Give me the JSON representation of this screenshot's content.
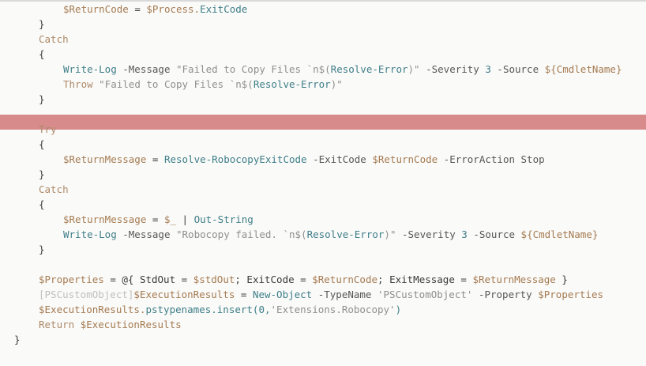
{
  "editor": {
    "lines": [
      {
        "indent": 80,
        "tokens": [
          {
            "t": "$ReturnCode",
            "c": "var"
          },
          {
            "t": " = ",
            "c": "plain"
          },
          {
            "t": "$Process.",
            "c": "var"
          },
          {
            "t": "ExitCode",
            "c": "cmd"
          }
        ]
      },
      {
        "indent": 49,
        "tokens": [
          {
            "t": "}",
            "c": "br"
          }
        ]
      },
      {
        "indent": 49,
        "tokens": [
          {
            "t": "Catch",
            "c": "kw"
          }
        ]
      },
      {
        "indent": 49,
        "tokens": [
          {
            "t": "{",
            "c": "br"
          }
        ]
      },
      {
        "indent": 80,
        "tokens": [
          {
            "t": "Write-Log",
            "c": "cmd"
          },
          {
            "t": " -Message ",
            "c": "param"
          },
          {
            "t": "\"Failed to Copy Files `n$(",
            "c": "str"
          },
          {
            "t": "Resolve-Error",
            "c": "cmd"
          },
          {
            "t": ")\"",
            "c": "str"
          },
          {
            "t": " -Severity ",
            "c": "param"
          },
          {
            "t": "3",
            "c": "cmd"
          },
          {
            "t": " -Source ",
            "c": "param"
          },
          {
            "t": "${CmdletName}",
            "c": "var"
          }
        ]
      },
      {
        "indent": 80,
        "tokens": [
          {
            "t": "Throw",
            "c": "kw"
          },
          {
            "t": " \"Failed to Copy Files `n$(",
            "c": "str"
          },
          {
            "t": "Resolve-Error",
            "c": "cmd"
          },
          {
            "t": ")\"",
            "c": "str"
          }
        ]
      },
      {
        "indent": 49,
        "tokens": [
          {
            "t": "}",
            "c": "br"
          }
        ]
      },
      {
        "indent": 0,
        "tokens": []
      },
      {
        "indent": 49,
        "tokens": [
          {
            "t": "Try",
            "c": "kw"
          }
        ]
      },
      {
        "indent": 49,
        "tokens": [
          {
            "t": "{",
            "c": "br"
          }
        ]
      },
      {
        "indent": 80,
        "tokens": [
          {
            "t": "$ReturnMessage",
            "c": "var"
          },
          {
            "t": " = ",
            "c": "plain"
          },
          {
            "t": "Resolve-RobocopyExitCode",
            "c": "cmd"
          },
          {
            "t": " -ExitCode ",
            "c": "param"
          },
          {
            "t": "$ReturnCode",
            "c": "var"
          },
          {
            "t": " -ErrorAction Stop",
            "c": "param"
          }
        ]
      },
      {
        "indent": 49,
        "tokens": [
          {
            "t": "}",
            "c": "br"
          }
        ]
      },
      {
        "indent": 49,
        "tokens": [
          {
            "t": "Catch",
            "c": "kw"
          }
        ]
      },
      {
        "indent": 49,
        "tokens": [
          {
            "t": "{",
            "c": "br"
          }
        ]
      },
      {
        "indent": 80,
        "tokens": [
          {
            "t": "$ReturnMessage",
            "c": "var"
          },
          {
            "t": " = ",
            "c": "plain"
          },
          {
            "t": "$_",
            "c": "var"
          },
          {
            "t": " | ",
            "c": "plain"
          },
          {
            "t": "Out-String",
            "c": "cmd"
          }
        ]
      },
      {
        "indent": 80,
        "tokens": [
          {
            "t": "Write-Log",
            "c": "cmd"
          },
          {
            "t": " -Message ",
            "c": "param"
          },
          {
            "t": "\"Robocopy failed. `n$(",
            "c": "str"
          },
          {
            "t": "Resolve-Error",
            "c": "cmd"
          },
          {
            "t": ")\"",
            "c": "str"
          },
          {
            "t": " -Severity ",
            "c": "param"
          },
          {
            "t": "3",
            "c": "cmd"
          },
          {
            "t": " -Source ",
            "c": "param"
          },
          {
            "t": "${CmdletName}",
            "c": "var"
          }
        ]
      },
      {
        "indent": 49,
        "tokens": [
          {
            "t": "}",
            "c": "br"
          }
        ]
      },
      {
        "indent": 0,
        "tokens": []
      },
      {
        "indent": 49,
        "tokens": [
          {
            "t": "$Properties",
            "c": "var"
          },
          {
            "t": " = @{ StdOut = ",
            "c": "plain"
          },
          {
            "t": "$stdOut",
            "c": "var"
          },
          {
            "t": "; ExitCode = ",
            "c": "plain"
          },
          {
            "t": "$ReturnCode",
            "c": "var"
          },
          {
            "t": "; ExitMessage = ",
            "c": "plain"
          },
          {
            "t": "$ReturnMessage",
            "c": "var"
          },
          {
            "t": " }",
            "c": "plain"
          }
        ]
      },
      {
        "indent": 49,
        "tokens": [
          {
            "t": "[PSCustomObject]",
            "c": "faint"
          },
          {
            "t": "$ExecutionResults",
            "c": "var"
          },
          {
            "t": " = ",
            "c": "plain"
          },
          {
            "t": "New-Object",
            "c": "cmd"
          },
          {
            "t": " -TypeName ",
            "c": "param"
          },
          {
            "t": "'PSCustomObject'",
            "c": "str"
          },
          {
            "t": " -Property ",
            "c": "param"
          },
          {
            "t": "$Properties",
            "c": "var"
          }
        ]
      },
      {
        "indent": 49,
        "tokens": [
          {
            "t": "$ExecutionResults.",
            "c": "var"
          },
          {
            "t": "pstypenames.insert(0,",
            "c": "cmd"
          },
          {
            "t": "'Extensions.Robocopy'",
            "c": "str"
          },
          {
            "t": ")",
            "c": "cmd"
          }
        ]
      },
      {
        "indent": 49,
        "tokens": [
          {
            "t": "Return",
            "c": "kw"
          },
          {
            "t": " ",
            "c": "plain"
          },
          {
            "t": "$ExecutionResults",
            "c": "var"
          }
        ]
      },
      {
        "indent": 18,
        "tokens": [
          {
            "t": "}",
            "c": "br"
          }
        ]
      }
    ]
  }
}
